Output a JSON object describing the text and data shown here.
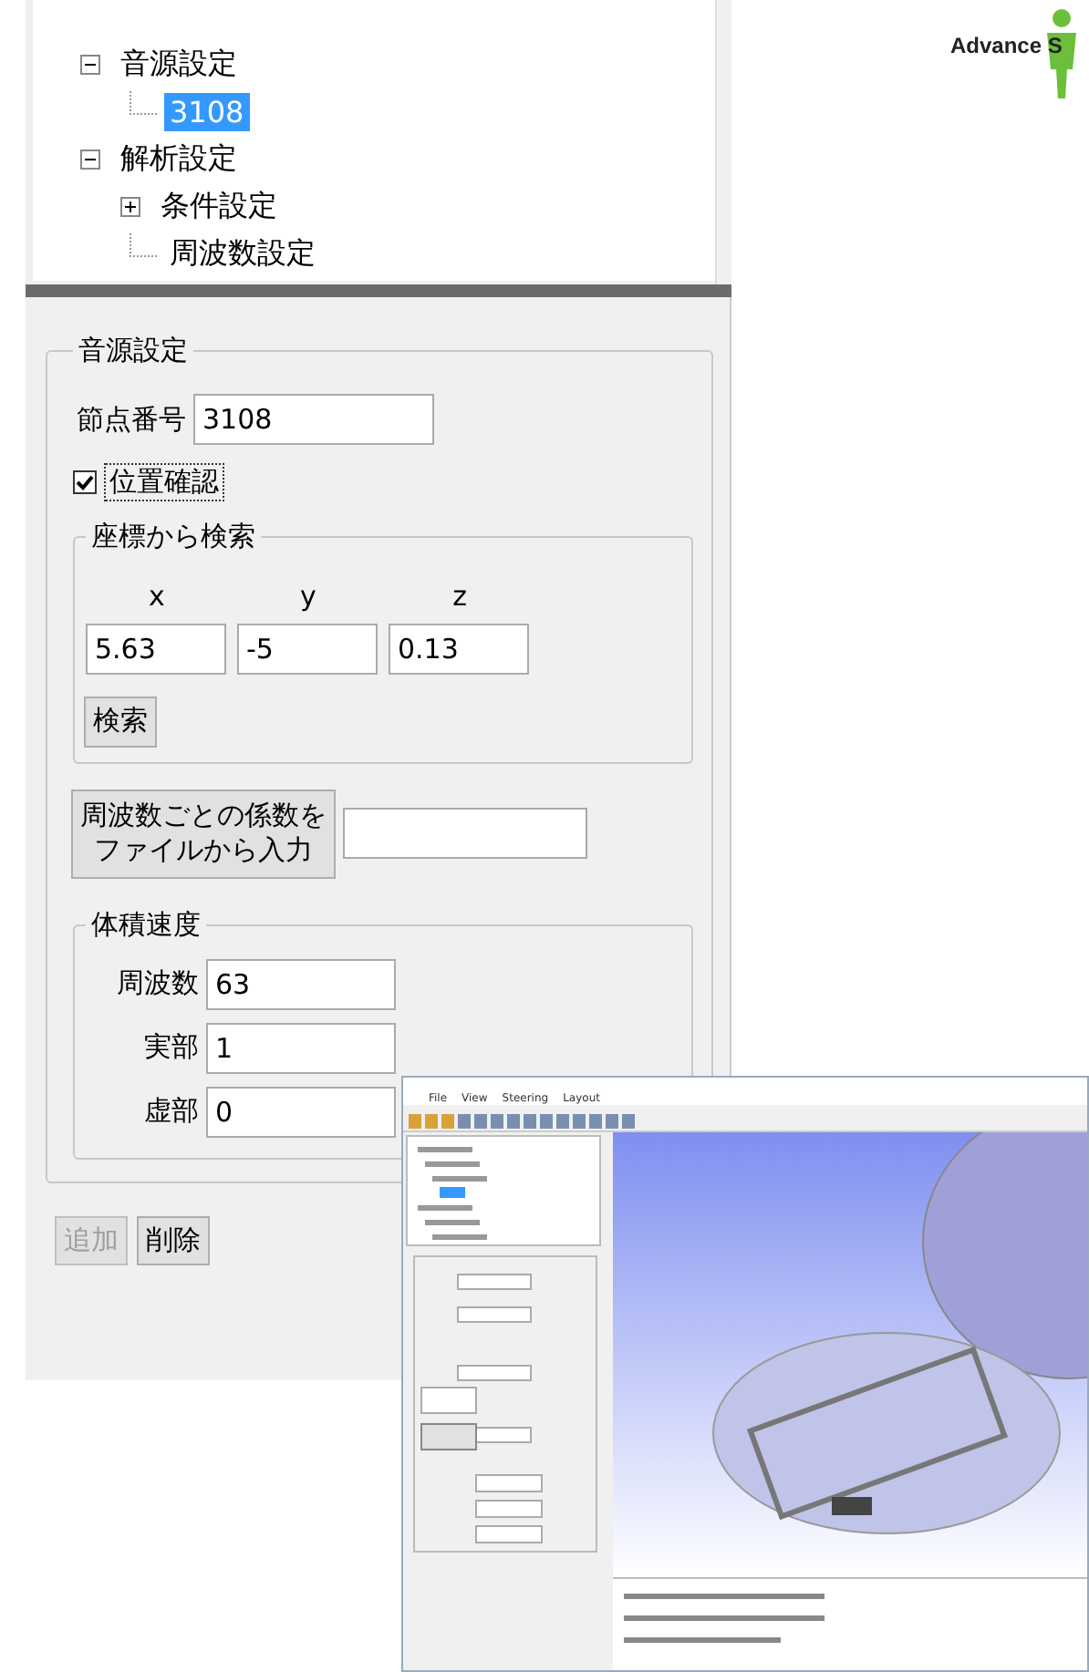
{
  "tree": [
    {
      "label": "音源設定",
      "expanded": true,
      "selected": false,
      "children": [
        {
          "label": "3108",
          "selected": true
        }
      ]
    },
    {
      "label": "解析設定",
      "expanded": true,
      "selected": false,
      "children": [
        {
          "label": "条件設定",
          "expanded": false,
          "selected": false
        },
        {
          "label": "周波数設定",
          "selected": false
        }
      ]
    }
  ],
  "logo": {
    "text": "Advance S"
  },
  "source_group": {
    "title": "音源設定",
    "node": {
      "label": "節点番号",
      "value": "3108"
    },
    "confirm": {
      "label": "位置確認",
      "checked": true
    },
    "coord_group": {
      "title": "座標から検索",
      "axes": [
        {
          "label": "x",
          "value": "5.63"
        },
        {
          "label": "y",
          "value": "-5"
        },
        {
          "label": "z",
          "value": "0.13"
        }
      ],
      "search_button": "検索"
    },
    "file_button": {
      "lines": [
        "周波数ごとの係数を",
        "ファイルから入力"
      ]
    },
    "velocity_group": {
      "title": "体積速度",
      "fields": [
        {
          "label": "周波数",
          "value": "63"
        },
        {
          "label": "実部",
          "value": "1"
        },
        {
          "label": "虚部",
          "value": "0"
        }
      ]
    }
  },
  "buttons": [
    {
      "label": "追加",
      "disabled": true
    },
    {
      "label": "削除",
      "disabled": false
    }
  ],
  "inset_window": {
    "menu": [
      "File",
      "View",
      "Steering",
      "Layout"
    ]
  }
}
